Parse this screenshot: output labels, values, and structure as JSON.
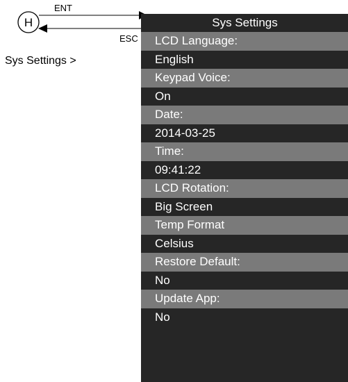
{
  "nav": {
    "home_key": "H",
    "enter_label": "ENT",
    "escape_label": "ESC"
  },
  "breadcrumb": "Sys Settings >",
  "screen": {
    "title": "Sys Settings",
    "settings": [
      {
        "label": "LCD Language:",
        "value": "English"
      },
      {
        "label": "Keypad Voice:",
        "value": "On"
      },
      {
        "label": "Date:",
        "value": "2014-03-25"
      },
      {
        "label": "Time:",
        "value": "09:41:22"
      },
      {
        "label": "LCD Rotation:",
        "value": "Big Screen"
      },
      {
        "label": "Temp Format",
        "value": "Celsius"
      },
      {
        "label": "Restore Default:",
        "value": "No"
      },
      {
        "label": "Update App:",
        "value": "No"
      }
    ]
  },
  "colors": {
    "screen_background": "#262626",
    "label_row_background": "#7a7a7a",
    "screen_text": "#ffffff"
  }
}
